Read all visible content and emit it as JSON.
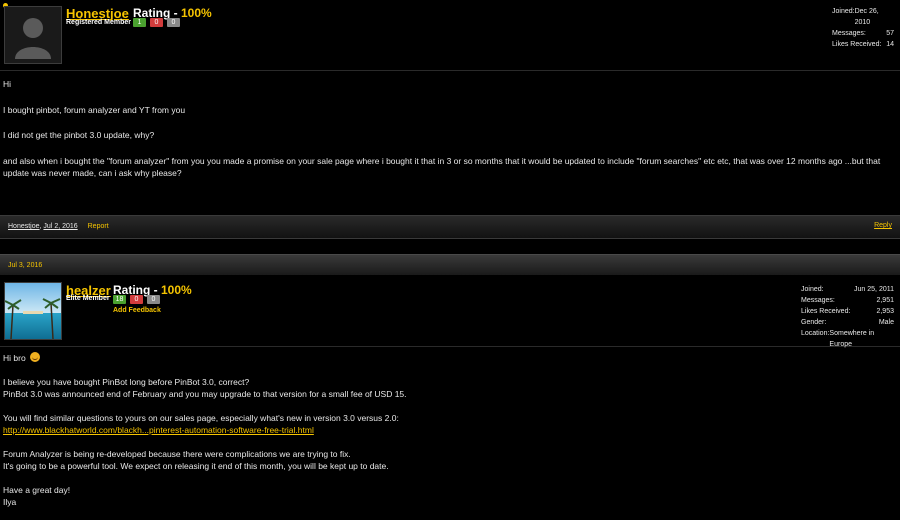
{
  "post1": {
    "username": "Honestjoe",
    "user_title": "Registered Member",
    "rating_label": "Rating - ",
    "rating_value": "100%",
    "chips": [
      "1",
      "0",
      "0"
    ],
    "stats": [
      {
        "label": "Joined:",
        "value": "Dec 26, 2010"
      },
      {
        "label": "Messages:",
        "value": "57"
      },
      {
        "label": "Likes Received:",
        "value": "14"
      }
    ],
    "body": [
      "Hi",
      "I bought pinbot, forum analyzer and YT from you",
      "I did not get the pinbot 3.0 update, why?",
      "and also when i bought the \"forum analyzer\" from you you made a promise on your sale page where i bought it that in 3 or so months that it would be updated to include \"forum searches\" etc etc, that was over 12 months ago ...but that update was never made, can i ask why please?"
    ],
    "footer_user": "Honestjoe",
    "footer_date": "Jul 2, 2016",
    "report": "Report",
    "reply": "Reply"
  },
  "date_bar": "Jul 3, 2016",
  "post2": {
    "username": "healzer",
    "user_title": "Elite Member",
    "rating_label": "Rating - ",
    "rating_value": "100%",
    "chips": [
      "18",
      "0",
      "0"
    ],
    "add_feedback": "Add Feedback",
    "stats": [
      {
        "label": "Joined:",
        "value": "Jun 25, 2011"
      },
      {
        "label": "Messages:",
        "value": "2,951"
      },
      {
        "label": "Likes Received:",
        "value": "2,953"
      },
      {
        "label": "Gender:",
        "value": "Male"
      },
      {
        "label": "Location:",
        "value": "Somewhere in Europe"
      }
    ],
    "greeting": "Hi bro",
    "para1_line1": "I believe you have bought PinBot long before PinBot 3.0, correct?",
    "para1_line2": "PinBot 3.0 was announced end of February and you may upgrade to that version for a small fee of USD 15.",
    "para2_line1": "You will find similar questions to yours on our sales page, especially what's new in version 3.0 versus 2.0:",
    "para2_link": "http://www.blackhatworld.com/blackh...pinterest-automation-software-free-trial.html",
    "para3_line1": "Forum Analyzer is being re-developed because there were complications we are trying to fix.",
    "para3_line2": "It's going to be a powerful tool. We expect on releasing it end of this month, you will be kept up to date.",
    "closing_line1": "Have a great day!",
    "closing_line2": "Ilya"
  }
}
